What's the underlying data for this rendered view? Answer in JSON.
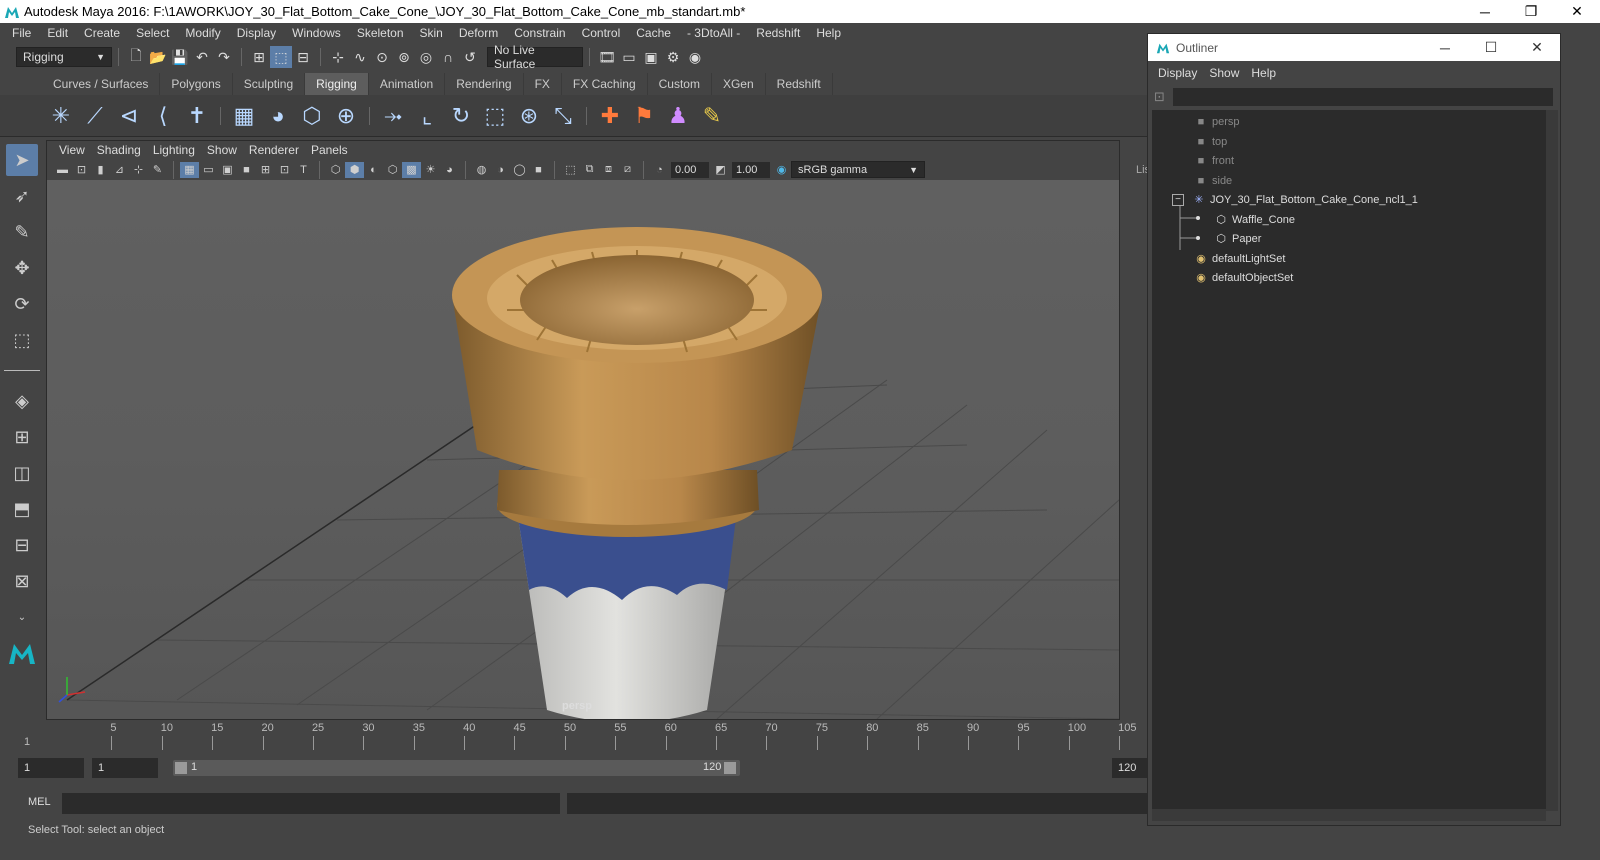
{
  "window": {
    "title": "Autodesk Maya 2016: F:\\1AWORK\\JOY_30_Flat_Bottom_Cake_Cone_\\JOY_30_Flat_Bottom_Cake_Cone_mb_standart.mb*",
    "minimize_icon": "minimize-icon",
    "restore_icon": "restore-icon",
    "close_icon": "close-icon"
  },
  "menubar": [
    "File",
    "Edit",
    "Create",
    "Select",
    "Modify",
    "Display",
    "Windows",
    "Skeleton",
    "Skin",
    "Deform",
    "Constrain",
    "Control",
    "Cache",
    "- 3DtoAll -",
    "Redshift",
    "Help"
  ],
  "statusline": {
    "menuset": "Rigging",
    "live_surface": "No Live Surface"
  },
  "shelf_tabs": [
    "Curves / Surfaces",
    "Polygons",
    "Sculpting",
    "Rigging",
    "Animation",
    "Rendering",
    "FX",
    "FX Caching",
    "Custom",
    "XGen",
    "Redshift"
  ],
  "active_shelf_tab": "Rigging",
  "panel_menu": [
    "View",
    "Shading",
    "Lighting",
    "Show",
    "Renderer",
    "Panels"
  ],
  "panel_toolbar": {
    "exposure": "0.00",
    "gamma": "1.00",
    "color_space": "sRGB gamma"
  },
  "viewport": {
    "camera": "persp"
  },
  "timeline": {
    "ticks": [
      "5",
      "10",
      "15",
      "20",
      "25",
      "30",
      "35",
      "40",
      "45",
      "50",
      "55",
      "60",
      "65",
      "70",
      "75",
      "80",
      "85",
      "90",
      "95",
      "100",
      "105"
    ],
    "current_frame": "1"
  },
  "range": {
    "start": "1",
    "anim_start": "1",
    "slider_start": "1",
    "slider_end": "120",
    "end": "120"
  },
  "command_line": {
    "label": "MEL"
  },
  "help_line": "Select Tool: select an object",
  "right_strip_label": "Lis",
  "outliner": {
    "title": "Outliner",
    "menu": [
      "Display",
      "Show",
      "Help"
    ],
    "items": [
      {
        "label": "persp",
        "icon": "camera-icon"
      },
      {
        "label": "top",
        "icon": "camera-icon"
      },
      {
        "label": "front",
        "icon": "camera-icon"
      },
      {
        "label": "side",
        "icon": "camera-icon"
      },
      {
        "label": "JOY_30_Flat_Bottom_Cake_Cone_ncl1_1",
        "icon": "group-icon"
      },
      {
        "label": "Waffle_Cone",
        "icon": "mesh-icon"
      },
      {
        "label": "Paper",
        "icon": "mesh-icon"
      },
      {
        "label": "defaultLightSet",
        "icon": "set-icon"
      },
      {
        "label": "defaultObjectSet",
        "icon": "set-icon"
      }
    ]
  }
}
